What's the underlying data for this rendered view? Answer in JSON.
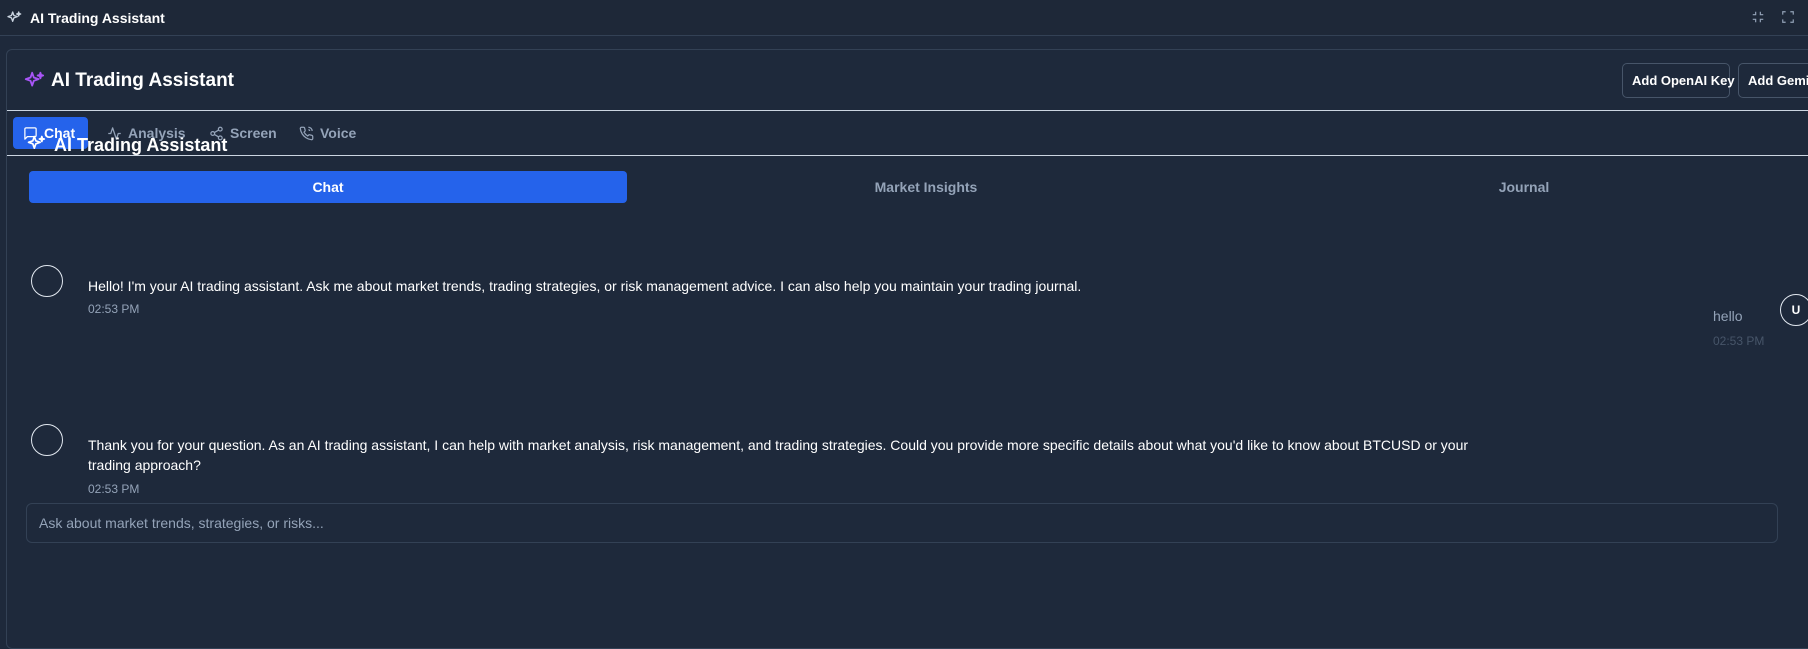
{
  "window": {
    "title": "AI Trading Assistant",
    "icon": "sparkles-icon",
    "controls": [
      "minimize-icon",
      "maximize-icon"
    ]
  },
  "header": {
    "title": "AI Trading Assistant",
    "icon": "sparkles-icon",
    "accent_color": "#a855f7",
    "buttons": {
      "openai": "Add OpenAI Key",
      "gemini": "Add Gemini Key"
    }
  },
  "toolbar": {
    "tabs": [
      {
        "label": "Chat",
        "icon": "chat-icon",
        "active": true
      },
      {
        "label": "Analysis",
        "icon": "activity-icon",
        "active": false
      },
      {
        "label": "Screen",
        "icon": "share-icon",
        "active": false
      },
      {
        "label": "Voice",
        "icon": "phone-icon",
        "active": false
      }
    ],
    "active_color": "#2563eb"
  },
  "assistant": {
    "title": "AI Trading Assistant",
    "subtabs": [
      {
        "label": "Chat",
        "active": true
      },
      {
        "label": "Market Insights",
        "active": false
      },
      {
        "label": "Journal",
        "active": false
      }
    ]
  },
  "messages": [
    {
      "role": "assistant",
      "text": "Hello! I'm your AI trading assistant. Ask me about market trends, trading strategies, or risk management advice. I can also help you maintain your trading journal.",
      "time": "02:53 PM"
    },
    {
      "role": "user",
      "avatar": "U",
      "text": "hello",
      "time": "02:53 PM"
    },
    {
      "role": "assistant",
      "text": "Thank you for your question. As an AI trading assistant, I can help with market analysis, risk management, and trading strategies. Could you provide more specific details about what you'd like to know about BTCUSD or your trading approach?",
      "time": "02:53 PM"
    }
  ],
  "input": {
    "placeholder": "Ask about market trends, strategies, or risks...",
    "value": ""
  }
}
